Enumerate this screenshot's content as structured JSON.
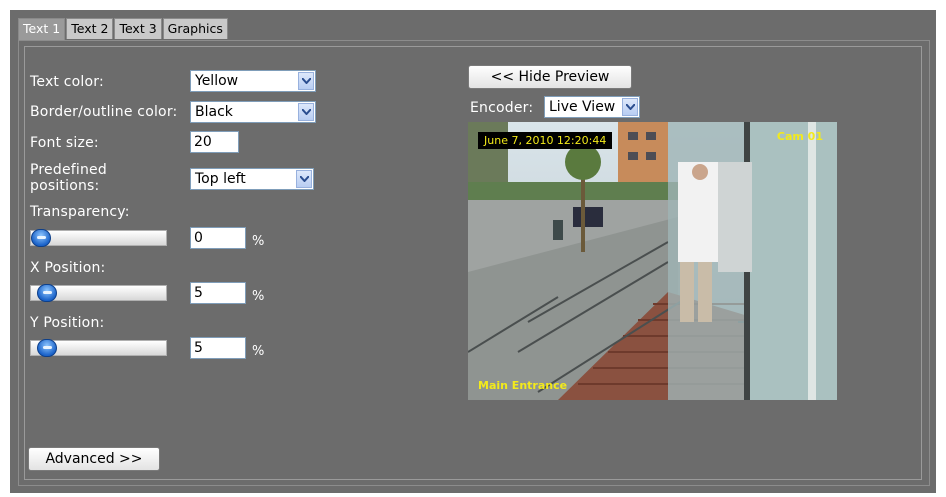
{
  "tabs": [
    {
      "label": "Text 1",
      "active": true
    },
    {
      "label": "Text 2",
      "active": false
    },
    {
      "label": "Text 3",
      "active": false
    },
    {
      "label": "Graphics",
      "active": false
    }
  ],
  "form": {
    "text_color": {
      "label": "Text color:",
      "value": "Yellow"
    },
    "border_color": {
      "label": "Border/outline color:",
      "value": "Black"
    },
    "font_size": {
      "label": "Font size:",
      "value": "20"
    },
    "predefined_positions": {
      "label_line1": "Predefined",
      "label_line2": "positions:",
      "value": "Top left"
    },
    "transparency": {
      "label": "Transparency:",
      "value": "0",
      "unit": "%"
    },
    "x_position": {
      "label": "X Position:",
      "value": "5",
      "unit": "%"
    },
    "y_position": {
      "label": "Y Position:",
      "value": "5",
      "unit": "%"
    }
  },
  "buttons": {
    "advanced": "Advanced >>",
    "hide_preview": "<< Hide Preview"
  },
  "encoder": {
    "label": "Encoder:",
    "value": "Live View"
  },
  "preview": {
    "timestamp": "June 7, 2010 12:20:44",
    "camera": "Cam 01",
    "location": "Main Entrance"
  },
  "colors": {
    "panel_bg": "#6c6c6c",
    "overlay_text": "#f3ea1b"
  }
}
